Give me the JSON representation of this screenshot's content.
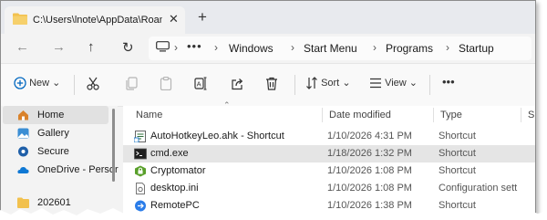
{
  "tab": {
    "title": "C:\\Users\\lnote\\AppData\\Roam",
    "close": "✕",
    "new_tab": "+"
  },
  "nav": {
    "back": "←",
    "forward": "→",
    "up": "↑",
    "refresh": "↻"
  },
  "address": {
    "overflow": "•••",
    "chevron": "›",
    "breadcrumbs": [
      "Windows",
      "Start Menu",
      "Programs",
      "Startup"
    ]
  },
  "toolbar": {
    "new_label": "New",
    "sort_label": "Sort",
    "view_label": "View",
    "more": "•••",
    "dropdown": "⌄"
  },
  "sidebar": {
    "items": [
      {
        "label": "Home",
        "icon": "home-icon",
        "selected": true
      },
      {
        "label": "Gallery",
        "icon": "gallery-icon",
        "selected": false
      },
      {
        "label": "Secure",
        "icon": "secure-icon",
        "selected": false
      },
      {
        "label": "OneDrive - Persor",
        "icon": "onedrive-icon",
        "selected": false
      },
      {
        "label": "202601",
        "icon": "folder-icon",
        "selected": false
      }
    ]
  },
  "columns": {
    "name": "Name",
    "date": "Date modified",
    "type": "Type",
    "size": "S"
  },
  "files": [
    {
      "name": "AutoHotkeyLeo.ahk - Shortcut",
      "date": "1/10/2026 4:31 PM",
      "type": "Shortcut",
      "icon": "ahk-shortcut-icon",
      "selected": false
    },
    {
      "name": "cmd.exe",
      "date": "1/18/2026 1:32 PM",
      "type": "Shortcut",
      "icon": "cmd-icon",
      "selected": true
    },
    {
      "name": "Cryptomator",
      "date": "1/10/2026 1:08 PM",
      "type": "Shortcut",
      "icon": "cryptomator-icon",
      "selected": false
    },
    {
      "name": "desktop.ini",
      "date": "1/10/2026 1:08 PM",
      "type": "Configuration sett",
      "icon": "ini-file-icon",
      "selected": false
    },
    {
      "name": "RemotePC",
      "date": "1/10/2026 1:38 PM",
      "type": "Shortcut",
      "icon": "remotepc-icon",
      "selected": false
    }
  ],
  "colors": {
    "accent": "#0067c0",
    "folder": "#f2c14e",
    "selection": "#e5e5e5"
  }
}
